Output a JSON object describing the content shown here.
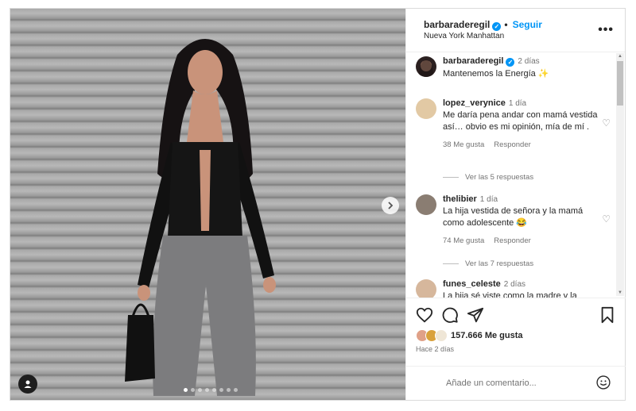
{
  "post": {
    "username": "barbaraderegil",
    "follow_label": "Seguir",
    "separator": "•",
    "location": "Nueva York Manhattan",
    "more_label": "•••"
  },
  "comments": [
    {
      "user": "barbaraderegil",
      "time": "2 días",
      "text": "Mantenemos la Energía ✨"
    },
    {
      "user": "lopez_verynice",
      "time": "1 día",
      "text": "Me daría pena andar con mamá vestida así… obvio es mi opinión, mía de mí .",
      "likes": "38 Me gusta",
      "reply": "Responder",
      "replies": "Ver las 5 respuestas"
    },
    {
      "user": "thelibier",
      "time": "1 día",
      "text": "La hija vestida de señora y la mamá como adolescente 😂",
      "likes": "74 Me gusta",
      "reply": "Responder",
      "replies": "Ver las 7 respuestas"
    },
    {
      "user": "funes_celeste",
      "time": "2 días",
      "text": "La hija sé viste como la madre y la"
    }
  ],
  "actions": {
    "likes": "157.666 Me gusta",
    "posted_ago": "Hace 2 días"
  },
  "add_comment": {
    "placeholder": "Añade un comentario..."
  },
  "colors": {
    "accent": "#0095f6",
    "text": "#262626",
    "muted": "#737373"
  }
}
